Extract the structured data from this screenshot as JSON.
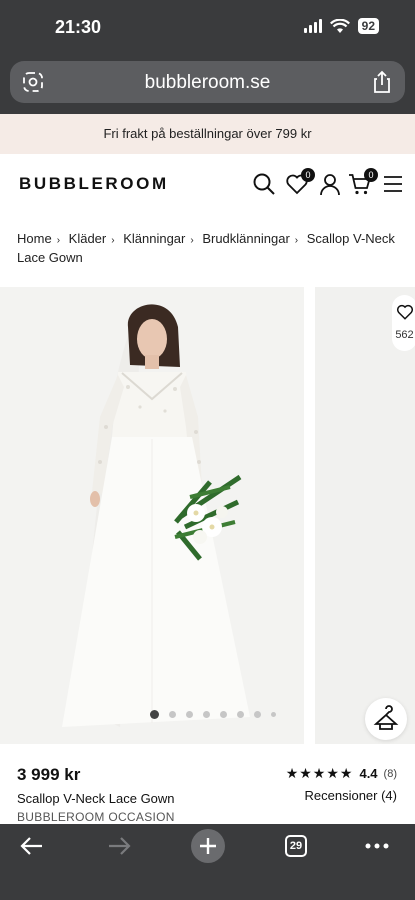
{
  "status": {
    "time": "21:30",
    "battery": "92"
  },
  "browser": {
    "url": "bubbleroom.se",
    "tab_count": "29"
  },
  "promo": {
    "text": "Fri frakt på beställningar över 799 kr"
  },
  "header": {
    "logo": "BUBBLEROOM",
    "wishlist_count": "0",
    "cart_count": "0"
  },
  "breadcrumb": [
    "Home",
    "Kläder",
    "Klänningar",
    "Brudklänningar",
    "Scallop V-Neck Lace Gown"
  ],
  "gallery": {
    "wishlist_count": "562",
    "image_count": 8,
    "active_index": 0
  },
  "product": {
    "price": "3 999 kr",
    "name": "Scallop V-Neck Lace Gown",
    "brand": "BUBBLEROOM OCCASION",
    "rating": "4.4",
    "rating_stars": "★★★★★",
    "rating_count": "(8)",
    "reviews_label": "Recensioner (4)"
  },
  "colors": {
    "chrome": "#3a3b3d",
    "promo_bg": "#f5ebe6",
    "accent": "#111111"
  }
}
